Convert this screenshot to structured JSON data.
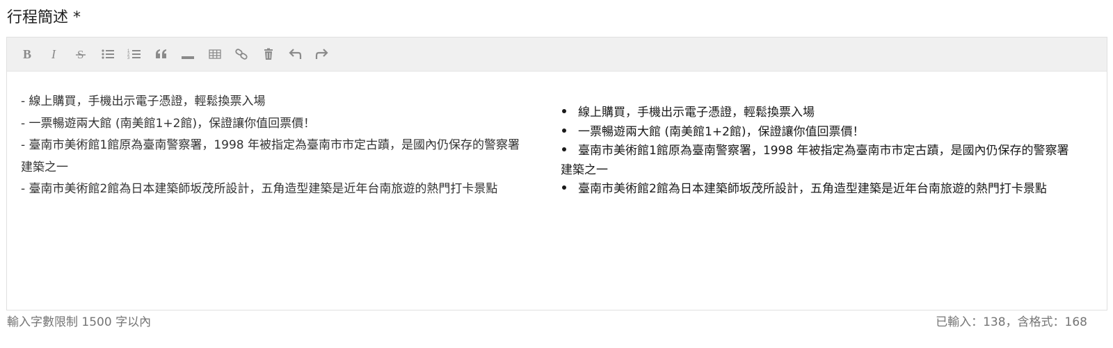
{
  "field": {
    "label": "行程簡述 *"
  },
  "toolbar": {
    "buttons": [
      {
        "name": "bold",
        "icon": "bold-icon"
      },
      {
        "name": "italic",
        "icon": "italic-icon"
      },
      {
        "name": "strikethrough",
        "icon": "strikethrough-icon"
      },
      {
        "name": "unordered-list",
        "icon": "bullet-list-icon"
      },
      {
        "name": "ordered-list",
        "icon": "numbered-list-icon"
      },
      {
        "name": "quote",
        "icon": "quote-icon"
      },
      {
        "name": "horizontal-rule",
        "icon": "horizontal-rule-icon"
      },
      {
        "name": "table",
        "icon": "table-icon"
      },
      {
        "name": "link",
        "icon": "link-icon"
      },
      {
        "name": "clear",
        "icon": "trash-icon"
      },
      {
        "name": "undo",
        "icon": "undo-icon"
      },
      {
        "name": "redo",
        "icon": "redo-icon"
      }
    ]
  },
  "editor": {
    "source_text": "- 線上購買，手機出示電子憑證，輕鬆換票入場\n- 一票暢遊兩大館 (南美館1+2館)，保證讓你值回票價！\n- 臺南市美術館1館原為臺南警察署，1998 年被指定為臺南市市定古蹟，是國內仍保存的警察署建築之一\n- 臺南市美術館2館為日本建築師坂茂所設計，五角造型建築是近年台南旅遊的熱門打卡景點",
    "preview_items": [
      "線上購買，手機出示電子憑證，輕鬆換票入場",
      "一票暢遊兩大館 (南美館1+2館)，保證讓你值回票價！",
      "臺南市美術館1館原為臺南警察署，1998 年被指定為臺南市市定古蹟，是國內仍保存的警察署建築之一",
      "臺南市美術館2館為日本建築師坂茂所設計，五角造型建築是近年台南旅遊的熱門打卡景點"
    ]
  },
  "footer": {
    "limit_text": "輸入字數限制 1500 字以內",
    "count_text": "已輸入：138，含格式：168"
  },
  "colors": {
    "toolbar_bg": "#f0f0f0",
    "icon": "#8a8a8a",
    "muted_text": "#757575"
  }
}
